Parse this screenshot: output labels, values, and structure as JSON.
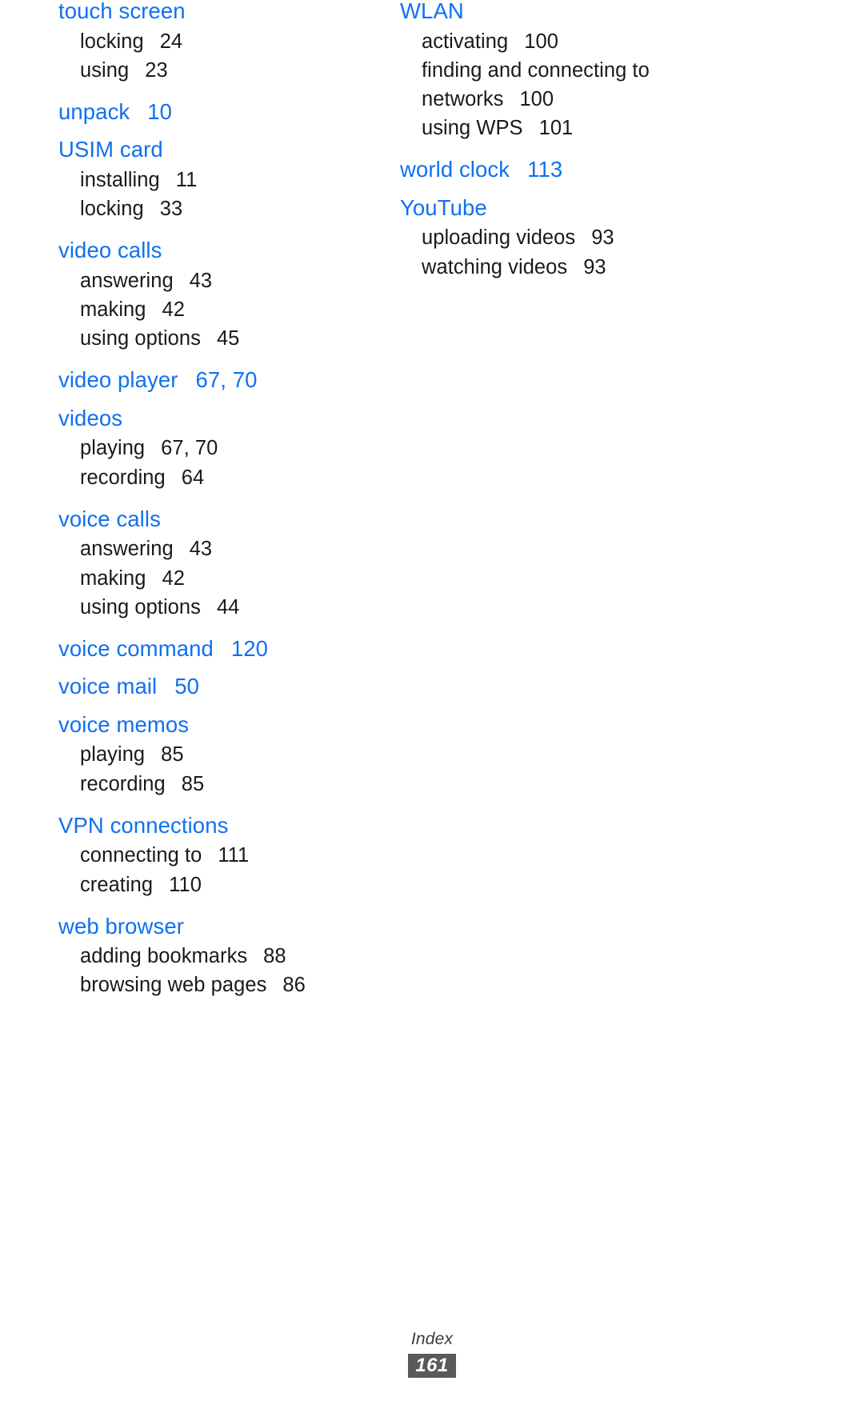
{
  "document": {
    "type": "book-index",
    "footer_label": "Index",
    "page_number": "161",
    "heading_color": "#1070f0",
    "badge_color": "#595959"
  },
  "columns": {
    "left": [
      {
        "heading": "touch screen",
        "heading_page": "",
        "entries": [
          {
            "label": "locking",
            "page": "24"
          },
          {
            "label": "using",
            "page": "23"
          }
        ]
      },
      {
        "heading": "unpack",
        "heading_page": "10",
        "entries": []
      },
      {
        "heading": "USIM card",
        "heading_page": "",
        "entries": [
          {
            "label": "installing",
            "page": "11"
          },
          {
            "label": "locking",
            "page": "33"
          }
        ]
      },
      {
        "heading": "video calls",
        "heading_page": "",
        "entries": [
          {
            "label": "answering",
            "page": "43"
          },
          {
            "label": "making",
            "page": "42"
          },
          {
            "label": "using options",
            "page": "45"
          }
        ]
      },
      {
        "heading": "video player",
        "heading_page": "67, 70",
        "entries": []
      },
      {
        "heading": "videos",
        "heading_page": "",
        "entries": [
          {
            "label": "playing",
            "page": "67, 70"
          },
          {
            "label": "recording",
            "page": "64"
          }
        ]
      },
      {
        "heading": "voice calls",
        "heading_page": "",
        "entries": [
          {
            "label": "answering",
            "page": "43"
          },
          {
            "label": "making",
            "page": "42"
          },
          {
            "label": "using options",
            "page": "44"
          }
        ]
      },
      {
        "heading": "voice command",
        "heading_page": "120",
        "entries": []
      },
      {
        "heading": "voice mail",
        "heading_page": "50",
        "entries": []
      },
      {
        "heading": "voice memos",
        "heading_page": "",
        "entries": [
          {
            "label": "playing",
            "page": "85"
          },
          {
            "label": "recording",
            "page": "85"
          }
        ]
      },
      {
        "heading": "VPN connections",
        "heading_page": "",
        "entries": [
          {
            "label": "connecting to",
            "page": "111"
          },
          {
            "label": "creating",
            "page": "110"
          }
        ]
      },
      {
        "heading": "web browser",
        "heading_page": "",
        "entries": [
          {
            "label": "adding bookmarks",
            "page": "88"
          },
          {
            "label": "browsing web pages",
            "page": "86"
          }
        ]
      }
    ],
    "right": [
      {
        "heading": "WLAN",
        "heading_page": "",
        "entries": [
          {
            "label": "activating",
            "page": "100"
          },
          {
            "label": "finding and connecting to networks",
            "page": "100",
            "wrap": true
          },
          {
            "label": "using WPS",
            "page": "101"
          }
        ]
      },
      {
        "heading": "world clock",
        "heading_page": "113",
        "entries": []
      },
      {
        "heading": "YouTube",
        "heading_page": "",
        "entries": [
          {
            "label": "uploading videos",
            "page": "93"
          },
          {
            "label": "watching videos",
            "page": "93"
          }
        ]
      }
    ]
  }
}
